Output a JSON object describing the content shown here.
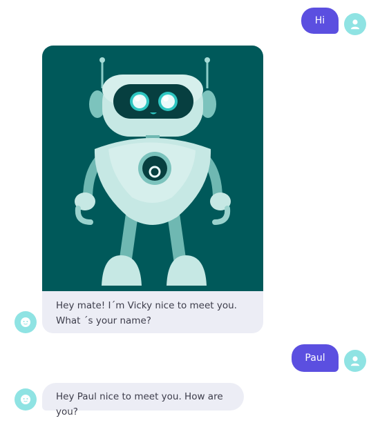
{
  "messages": {
    "user_1": "Hi",
    "bot_card_text": "Hey mate! I´m Vicky nice to meet you. What ´s your name?",
    "user_2": "Paul",
    "bot_2": "Hey Paul nice to meet you. How are you?"
  },
  "icons": {
    "user_avatar": "user-icon",
    "bot_avatar": "bot-face-icon",
    "card_image": "robot-illustration"
  },
  "colors": {
    "user_bubble": "#5b4fe0",
    "avatar_bg": "#8fe3e3",
    "bot_bubble": "#ecedf5",
    "card_image_bg": "#00595a"
  }
}
